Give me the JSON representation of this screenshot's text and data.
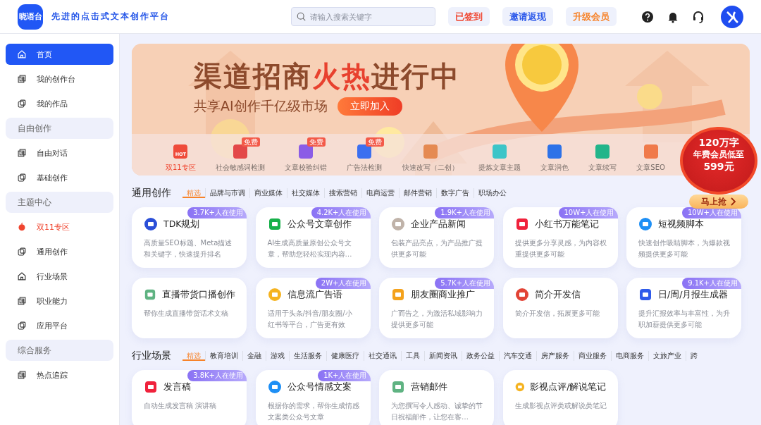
{
  "header": {
    "logo": "晓语台",
    "slogan": "先进的点击式文本创作平台",
    "search": {
      "placeholder": "请输入搜索关键字"
    },
    "actions": [
      {
        "label": "已签到",
        "color": "#f0452f"
      },
      {
        "label": "邀请返现",
        "color": "#2f5bea"
      },
      {
        "label": "升级会员",
        "color": "#f7832a"
      }
    ]
  },
  "sidebar": {
    "items": [
      {
        "kind": "item",
        "label": "首页",
        "selected": true
      },
      {
        "kind": "item",
        "label": "我的创作台",
        "selected": false
      },
      {
        "kind": "item",
        "label": "我的作品",
        "selected": false
      },
      {
        "kind": "section",
        "label": "自由创作"
      },
      {
        "kind": "item",
        "label": "自由对话",
        "selected": false
      },
      {
        "kind": "item",
        "label": "基础创作",
        "selected": false
      },
      {
        "kind": "section",
        "label": "主题中心"
      },
      {
        "kind": "hot",
        "label": "双11专区",
        "selected": false
      },
      {
        "kind": "item",
        "label": "通用创作",
        "selected": false
      },
      {
        "kind": "item",
        "label": "行业场景",
        "selected": false
      },
      {
        "kind": "item",
        "label": "职业能力",
        "selected": false
      },
      {
        "kind": "item",
        "label": "应用平台",
        "selected": false
      },
      {
        "kind": "section",
        "label": "综合服务"
      },
      {
        "kind": "item",
        "label": "热点追踪",
        "selected": false
      }
    ]
  },
  "banner": {
    "title": "渠道招商**火热**进行中",
    "subtitle": "共享AI创作千亿级市场",
    "button": "立即加入",
    "tools": [
      {
        "label": "双11专区",
        "selected": true,
        "badge": "HOT"
      },
      {
        "label": "社会敏感词检测",
        "selected": false,
        "tag": "免费"
      },
      {
        "label": "文章校验纠错",
        "selected": false,
        "tag": "免费"
      },
      {
        "label": "广告法检测",
        "selected": false,
        "tag": "免费"
      },
      {
        "label": "快速改写（二创）",
        "selected": false
      },
      {
        "label": "提炼文章主题",
        "selected": false
      },
      {
        "label": "文章润色",
        "selected": false
      },
      {
        "label": "文章续写",
        "selected": false
      },
      {
        "label": "文章SEO",
        "selected": false
      }
    ]
  },
  "promo": {
    "lines": [
      "120万字",
      "年费会员低至",
      "599元"
    ],
    "button": "马上抢"
  },
  "sections": [
    {
      "title": "通用创作",
      "tabs": [
        {
          "label": "精选",
          "selected": true
        },
        {
          "label": "品牌与市调",
          "selected": false
        },
        {
          "label": "商业媒体",
          "selected": false
        },
        {
          "label": "社交媒体",
          "selected": false
        },
        {
          "label": "搜索营销",
          "selected": false
        },
        {
          "label": "电商运营",
          "selected": false
        },
        {
          "label": "邮件营销",
          "selected": false
        },
        {
          "label": "数字广告",
          "selected": false
        },
        {
          "label": "职场办公",
          "selected": false
        }
      ],
      "cards": [
        {
          "title": "TDK规划",
          "usage": "3.7K+人在使用",
          "description": "高质量SEO标题、Meta描述和关键字，快速提升排名"
        },
        {
          "title": "公众号文章创作",
          "usage": "4.2K+人在使用",
          "description": "AI生成高质量原创公众号文章，帮助您轻松实现内容…"
        },
        {
          "title": "企业产品新闻",
          "usage": "1.9K+人在使用",
          "description": "包装产品亮点，为产品推广提供更多可能"
        },
        {
          "title": "小红书万能笔记",
          "usage": "10W+人在使用",
          "description": "提供更多分享灵感，为内容权重提供更多可能"
        },
        {
          "title": "短视频脚本",
          "usage": "10W+人在使用",
          "description": "快速创作吸睛脚本，为爆款视频提供更多可能"
        },
        {
          "title": "直播带货口播创作",
          "description": "帮你生成直播带货话术文稿"
        },
        {
          "title": "信息流广告语",
          "usage": "2W+人在使用",
          "description": "适用于头条/抖音/朋友圈/小红书等平台，广告更有效"
        },
        {
          "title": "朋友圈商业推广",
          "usage": "5.7K+人在使用",
          "description": "广而告之，为激活私域影响力提供更多可能"
        },
        {
          "title": "简介开发信",
          "description": "简介开发信，拓展更多可能"
        },
        {
          "title": "日/周/月报生成器",
          "usage": "9.1K+人在使用",
          "description": "提升汇报效率与丰富性，为升职加薪提供更多可能"
        }
      ]
    },
    {
      "title": "行业场景",
      "tabs": [
        {
          "label": "精选",
          "selected": true
        },
        {
          "label": "教育培训",
          "selected": false
        },
        {
          "label": "金融",
          "selected": false
        },
        {
          "label": "游戏",
          "selected": false
        },
        {
          "label": "生活服务",
          "selected": false
        },
        {
          "label": "健康医疗",
          "selected": false
        },
        {
          "label": "社交通讯",
          "selected": false
        },
        {
          "label": "工具",
          "selected": false
        },
        {
          "label": "新闻资讯",
          "selected": false
        },
        {
          "label": "政务公益",
          "selected": false
        },
        {
          "label": "汽车交通",
          "selected": false
        },
        {
          "label": "房产服务",
          "selected": false
        },
        {
          "label": "商业服务",
          "selected": false
        },
        {
          "label": "电商服务",
          "selected": false
        },
        {
          "label": "文旅产业",
          "selected": false
        },
        {
          "label": "跨",
          "selected": false
        }
      ],
      "cards": [
        {
          "title": "发言稿",
          "usage": "3.8K+人在使用",
          "description": "自动生成发言稿 演讲稿"
        },
        {
          "title": "公众号情感文案",
          "usage": "1K+人在使用",
          "description": "根据你的需求，帮你生成情感文案类公众号文章"
        },
        {
          "title": "营销邮件",
          "description": "为您撰写令人感动、诚挚的节日祝福邮件，让您在客…"
        },
        {
          "title": "影视点评/解说笔记",
          "description": "生成影视点评类或解说类笔记"
        }
      ]
    }
  ]
}
